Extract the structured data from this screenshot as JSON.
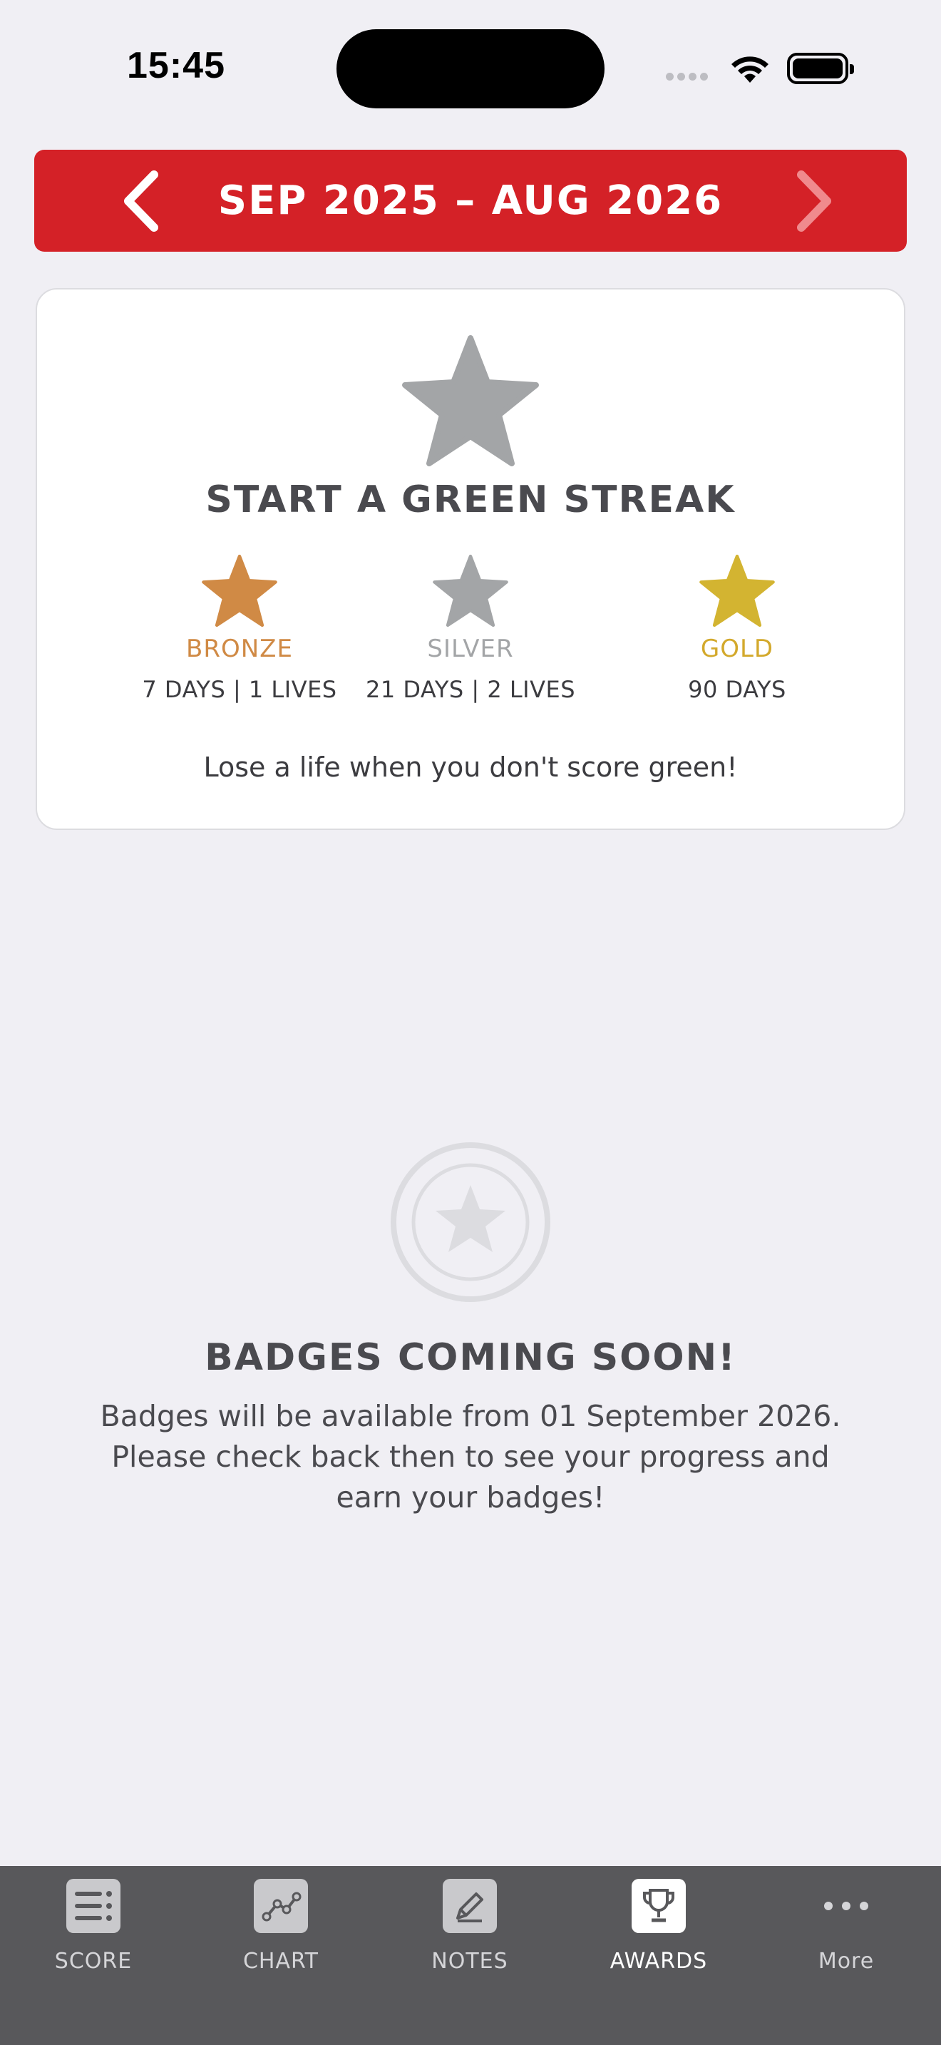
{
  "status_bar": {
    "time": "15:45"
  },
  "header": {
    "period": "SEP 2025 – AUG 2026"
  },
  "streak_card": {
    "title": "START A GREEN STREAK",
    "tiers": [
      {
        "name": "BRONZE",
        "requirement": "7 DAYS | 1 LIVES",
        "color": "#d08a45"
      },
      {
        "name": "SILVER",
        "requirement": "21 DAYS | 2 LIVES",
        "color": "#a3a5a7"
      },
      {
        "name": "GOLD",
        "requirement": "90 DAYS",
        "color": "#d3b431"
      }
    ],
    "note": "Lose a life when you don't score green!"
  },
  "badges": {
    "title": "BADGES COMING SOON!",
    "description": "Badges will be available from 01 September 2026. Please check back then to see your progress and earn your badges!"
  },
  "tab_bar": {
    "tabs": [
      {
        "label": "SCORE",
        "icon": "list-icon",
        "active": false
      },
      {
        "label": "CHART",
        "icon": "chart-icon",
        "active": false
      },
      {
        "label": "NOTES",
        "icon": "pencil-icon",
        "active": false
      },
      {
        "label": "AWARDS",
        "icon": "trophy-icon",
        "active": true
      },
      {
        "label": "More",
        "icon": "ellipsis-icon",
        "active": false
      }
    ]
  },
  "colors": {
    "brand_red": "#d42127",
    "tab_bar": "#58585b",
    "background": "#f0eff4"
  }
}
